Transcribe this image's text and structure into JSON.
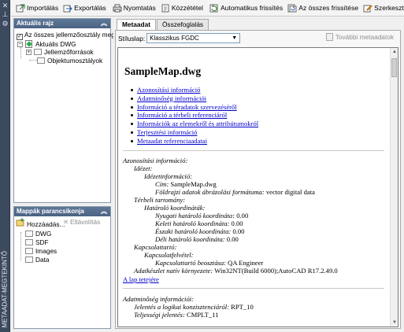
{
  "sidebar": {
    "title": "METAADAT-MEGTEKINTŐ"
  },
  "toolbar": {
    "import": "Importálás",
    "export": "Exportálás",
    "print": "Nyomtatás",
    "publish": "Közzététel",
    "auto_refresh": "Automatikus frissítés",
    "refresh_all": "Az összes frissítése",
    "edit": "Szerkesztés"
  },
  "current_map_panel": {
    "title": "Aktuális rajz",
    "checkbox_label": "Az összes jellemzőosztály megj",
    "root": "Aktuális DWG",
    "children": [
      "Jellemzőforrások",
      "Objektumosztályok"
    ]
  },
  "folders_panel": {
    "title": "Mappák parancsikonja",
    "add": "Hozzáadás...",
    "remove": "Eltávolítás",
    "items": [
      "DWG",
      "SDF",
      "Images",
      "Data"
    ]
  },
  "tabs": {
    "metadata": "Metaadat",
    "summary": "Összefoglalás"
  },
  "style": {
    "label": "Stíluslap:",
    "value": "Klasszikus FGDC",
    "more": "További metaadatok"
  },
  "doc": {
    "title": "SampleMap.dwg",
    "toc": [
      "Azonosítási információ",
      "Adatminőség információi",
      "Információ a téradatok szervezéséről",
      "Információ a térbeli referenciáról",
      "Információk az elemekről és attribútumokról",
      "Terjesztési információ",
      "Metaadat referenciaadatai"
    ],
    "identification": {
      "heading": "Azonosítási információ:",
      "citation": "Idézet:",
      "citation_info": "Idézetinformáció:",
      "title_label": "Cím:",
      "title_value": "SampleMap.dwg",
      "geoform_label": "Földrajzi adatok ábrázolási formátuma:",
      "geoform_value": "vector digital data",
      "spatial_domain": "Térbeli tartomány:",
      "bounding": "Határoló koordináták:",
      "west_label": "Nyugati határoló koordináta:",
      "west_value": "0.00",
      "east_label": "Keleti határoló koordináta:",
      "east_value": "0.00",
      "north_label": "Északi határoló koordináta:",
      "north_value": "0.00",
      "south_label": "Déli határoló koordináta:",
      "south_value": "0.00",
      "contact": "Kapcsolattartó:",
      "contact_info": "Kapcsolatfelvétel:",
      "position_label": "Kapcsolattartó beosztása:",
      "position_value": "QA Engineer",
      "native_label": "Adatkészlet natív környezete:",
      "native_value": "Win32NT(Build 6000);AutoCAD R17.2.49.0",
      "top_link": "A lap tetejére"
    },
    "quality": {
      "heading": "Adatminőség információi:",
      "logical_label": "Jelentés a logikai konzisztenciáról:",
      "logical_value": "RPT_10",
      "complete_label": "Teljességi jelentés:",
      "complete_value": "CMPLT_11"
    }
  }
}
